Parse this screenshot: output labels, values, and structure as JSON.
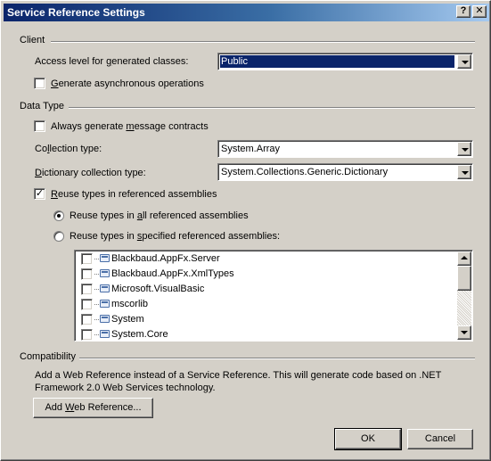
{
  "window": {
    "title": "Service Reference Settings",
    "help_button": "?",
    "close_button": "✕"
  },
  "client": {
    "group_label": "Client",
    "access_level_label_pre": "Access level for ",
    "access_level_label_u": "g",
    "access_level_label_post": "enerated classes:",
    "access_level_value": "Public",
    "async_checked": false,
    "async_label_u": "G",
    "async_label_post": "enerate asynchronous operations"
  },
  "data_type": {
    "group_label": "Data Type",
    "always_msg_checked": false,
    "always_msg_label_pre": "Always generate ",
    "always_msg_label_u": "m",
    "always_msg_label_post": "essage contracts",
    "collection_label_pre": "Co",
    "collection_label_u": "l",
    "collection_label_post": "lection type:",
    "collection_value": "System.Array",
    "dictionary_label_u": "D",
    "dictionary_label_post": "ictionary collection type:",
    "dictionary_value": "System.Collections.Generic.Dictionary",
    "reuse_checked": true,
    "reuse_label_u": "R",
    "reuse_label_post": "euse types in referenced assemblies",
    "reuse_all_label_pre": "Reuse types in ",
    "reuse_all_label_u": "a",
    "reuse_all_label_post": "ll referenced assemblies",
    "reuse_specified_label_pre": "Reuse types in ",
    "reuse_specified_label_u": "s",
    "reuse_specified_label_post": "pecified referenced assemblies:",
    "selected_mode": "all",
    "assemblies": [
      {
        "name": "Blackbaud.AppFx.Server",
        "checked": false
      },
      {
        "name": "Blackbaud.AppFx.XmlTypes",
        "checked": false
      },
      {
        "name": "Microsoft.VisualBasic",
        "checked": false
      },
      {
        "name": "mscorlib",
        "checked": false
      },
      {
        "name": "System",
        "checked": false
      },
      {
        "name": "System.Core",
        "checked": false
      }
    ]
  },
  "compatibility": {
    "group_label": "Compatibility",
    "description_line1": "Add a Web Reference instead of a Service Reference. This will generate code based on .NET",
    "description_line2": "Framework 2.0 Web Services technology.",
    "add_web_ref_pre": "Add ",
    "add_web_ref_u": "W",
    "add_web_ref_post": "eb Reference..."
  },
  "buttons": {
    "ok": "OK",
    "cancel": "Cancel"
  },
  "colors": {
    "dialog_bg": "#d4d0c8",
    "title_active": "#0a246a",
    "selection": "#0a246a"
  }
}
